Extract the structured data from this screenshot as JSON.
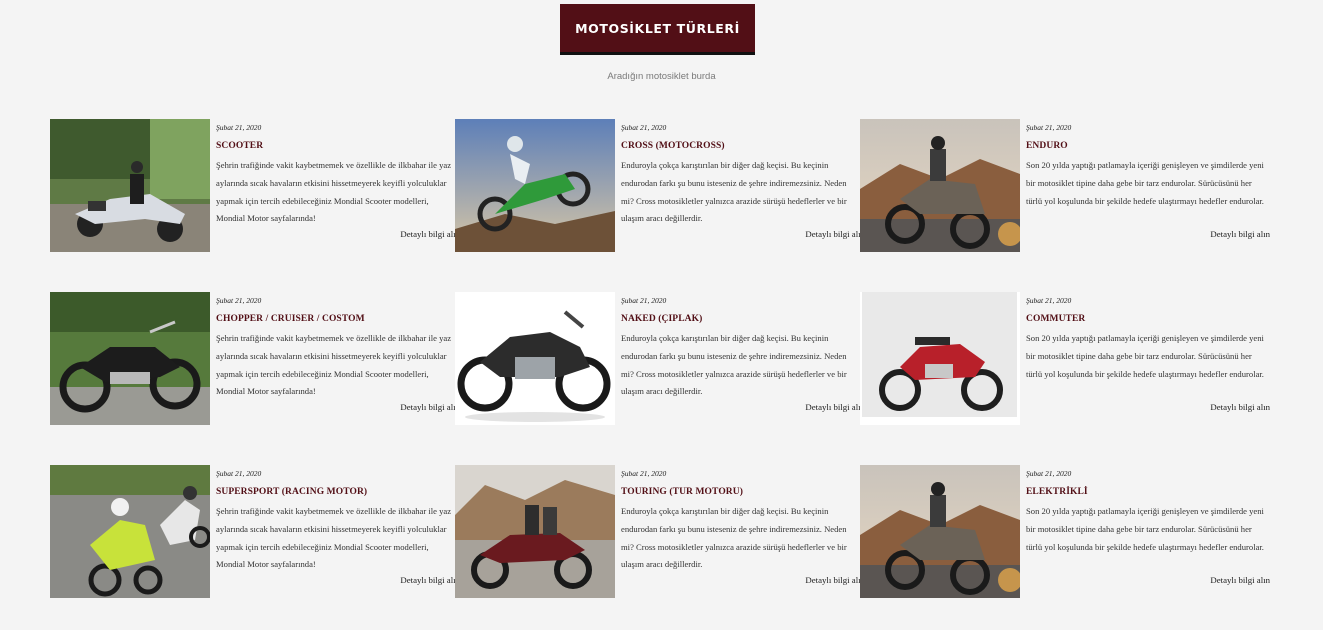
{
  "header": {
    "title": "MOTOSİKLET TÜRLERİ",
    "subtitle": "Aradığın motosiklet burda"
  },
  "cards": [
    {
      "date": "Şubat 21, 2020",
      "title": "SCOOTER",
      "description": "Şehrin trafiğinde vakit kaybetmemek ve özellikle de ilkbahar ile yaz aylarında sıcak havaların etkisini hissetmeyerek keyifli yolculuklar yapmak için tercih edebileceğiniz Mondial Scooter modelleri, Mondial Motor sayfalarında!",
      "link": "Detaylı bilgi alın"
    },
    {
      "date": "Şubat 21, 2020",
      "title": "CROSS (MOTOCROSS)",
      "description": "Enduroyla çokça karıştırılan bir diğer dağ keçisi. Bu keçinin endurodan farkı şu bunu isteseniz de şehre indiremezsiniz. Neden mi? Cross motosikletler yalnızca arazide sürüşü hedeflerler ve bir ulaşım aracı değillerdir.",
      "link": "Detaylı bilgi alın"
    },
    {
      "date": "Şubat 21, 2020",
      "title": "ENDURO",
      "description": "Son 20 yılda yaptığı patlamayla içeriği genişleyen ve şimdilerde yeni bir motosiklet tipine daha gebe bir tarz endurolar. Sürücüsünü her türlü yol koşulunda bir şekilde hedefe ulaştırmayı hedefler endurolar.",
      "link": "Detaylı bilgi alın"
    },
    {
      "date": "Şubat 21, 2020",
      "title": "CHOPPER / CRUISER / COSTOM",
      "description": "Şehrin trafiğinde vakit kaybetmemek ve özellikle de ilkbahar ile yaz aylarında sıcak havaların etkisini hissetmeyerek keyifli yolculuklar yapmak için tercih edebileceğiniz Mondial Scooter modelleri, Mondial Motor sayfalarında!",
      "link": "Detaylı bilgi alın"
    },
    {
      "date": "Şubat 21, 2020",
      "title": "NAKED (ÇIPLAK)",
      "description": "Enduroyla çokça karıştırılan bir diğer dağ keçisi. Bu keçinin endurodan farkı şu bunu isteseniz de şehre indiremezsiniz. Neden mi? Cross motosikletler yalnızca arazide sürüşü hedeflerler ve bir ulaşım aracı değillerdir.",
      "link": "Detaylı bilgi alın"
    },
    {
      "date": "Şubat 21, 2020",
      "title": "COMMUTER",
      "description": "Son 20 yılda yaptığı patlamayla içeriği genişleyen ve şimdilerde yeni bir motosiklet tipine daha gebe bir tarz endurolar. Sürücüsünü her türlü yol koşulunda bir şekilde hedefe ulaştırmayı hedefler endurolar.",
      "link": "Detaylı bilgi alın"
    },
    {
      "date": "Şubat 21, 2020",
      "title": "SUPERSPORT (RACING MOTOR)",
      "description": "Şehrin trafiğinde vakit kaybetmemek ve özellikle de ilkbahar ile yaz aylarında sıcak havaların etkisini hissetmeyerek keyifli yolculuklar yapmak için tercih edebileceğiniz Mondial Scooter modelleri, Mondial Motor sayfalarında!",
      "link": "Detaylı bilgi alın"
    },
    {
      "date": "Şubat 21, 2020",
      "title": "TOURING (TUR MOTORU)",
      "description": "Enduroyla çokça karıştırılan bir diğer dağ keçisi. Bu keçinin endurodan farkı şu bunu isteseniz de şehre indiremezsiniz. Neden mi? Cross motosikletler yalnızca arazide sürüşü hedeflerler ve bir ulaşım aracı değillerdir.",
      "link": "Detaylı bilgi alın"
    },
    {
      "date": "Şubat 21, 2020",
      "title": "ELEKTRİKLİ",
      "description": "Son 20 yılda yaptığı patlamayla içeriği genişleyen ve şimdilerde yeni bir motosiklet tipine daha gebe bir tarz endurolar. Sürücüsünü her türlü yol koşulunda bir şekilde hedefe ulaştırmayı hedefler endurolar.",
      "link": "Detaylı bilgi alın"
    }
  ],
  "colors": {
    "accent": "#520f16",
    "background": "#f4f4f4"
  }
}
